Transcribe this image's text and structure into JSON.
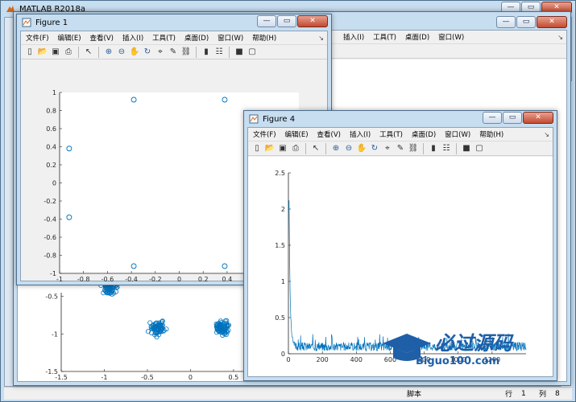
{
  "matlab": {
    "title": "MATLAB R2018a",
    "status_script": "脚本",
    "status_row_label": "行",
    "status_row": "1",
    "status_col_label": "列",
    "status_col": "8"
  },
  "fig1": {
    "title": "Figure 1",
    "menu": [
      "文件(F)",
      "编辑(E)",
      "查看(V)",
      "插入(I)",
      "工具(T)",
      "桌面(D)",
      "窗口(W)",
      "帮助(H)"
    ]
  },
  "fig4": {
    "title": "Figure 4",
    "menu": [
      "文件(F)",
      "编辑(E)",
      "查看(V)",
      "插入(I)",
      "工具(T)",
      "桌面(D)",
      "窗口(W)",
      "帮助(H)"
    ]
  },
  "fig_bg": {
    "menu": [
      "插入(I)",
      "工具(T)",
      "桌面(D)",
      "窗口(W)"
    ]
  },
  "watermark": {
    "text": "必过源码",
    "url": "Biguo100.com"
  },
  "icons": [
    "new-file-icon",
    "open-icon",
    "save-icon",
    "print-icon",
    "pointer-icon",
    "zoom-in-icon",
    "zoom-out-icon",
    "pan-icon",
    "rotate-icon",
    "data-cursor-icon",
    "brush-icon",
    "link-icon",
    "colorbar-icon",
    "legend-icon",
    "hide-plot-tools-icon",
    "show-plot-tools-icon"
  ],
  "chart_data": [
    {
      "type": "scatter",
      "title": "",
      "xlabel": "",
      "ylabel": "",
      "xlim": [
        -1,
        1
      ],
      "ylim": [
        -1,
        1
      ],
      "xticks": [
        "-1",
        "-0.8",
        "-0.6",
        "-0.4",
        "-0.2",
        "0",
        "0.2",
        "0.4"
      ],
      "yticks": [
        "-1",
        "-0.8",
        "-0.6",
        "-0.4",
        "-0.2",
        "0",
        "0.2",
        "0.4",
        "0.6",
        "0.8",
        "1"
      ],
      "marker": "o",
      "color": "#0072bd",
      "points": [
        [
          -0.92,
          0.38
        ],
        [
          -0.38,
          0.92
        ],
        [
          0.38,
          0.92
        ],
        [
          -0.92,
          -0.38
        ],
        [
          -0.38,
          -0.92
        ],
        [
          0.38,
          -0.92
        ]
      ]
    },
    {
      "type": "scatter",
      "title": "",
      "xlabel": "",
      "ylabel": "",
      "xlim": [
        -1.5,
        0.8
      ],
      "ylim": [
        -1.5,
        -0.45
      ],
      "xticks": [
        "-1.5",
        "-1",
        "-0.5",
        "0",
        "0.5"
      ],
      "yticks": [
        "-1.5",
        "-1",
        "-0.5"
      ],
      "marker": "o",
      "color": "#0072bd",
      "clusters": [
        {
          "x": -0.92,
          "y": -0.38,
          "spread": 0.07
        },
        {
          "x": -0.38,
          "y": -0.92,
          "spread": 0.07
        },
        {
          "x": 0.38,
          "y": -0.92,
          "spread": 0.07
        }
      ]
    },
    {
      "type": "line",
      "title": "",
      "xlabel": "",
      "ylabel": "",
      "xlim": [
        0,
        1400
      ],
      "ylim": [
        0,
        2.5
      ],
      "xticks": [
        "0",
        "200",
        "400",
        "600",
        "800",
        "1000",
        "1200"
      ],
      "yticks": [
        "0",
        "0.5",
        "1",
        "1.5",
        "2",
        "2.5"
      ],
      "color": "#0072bd",
      "description_values": {
        "start": 2.0,
        "decay_to": 0.1,
        "noise": 0.05
      }
    }
  ]
}
